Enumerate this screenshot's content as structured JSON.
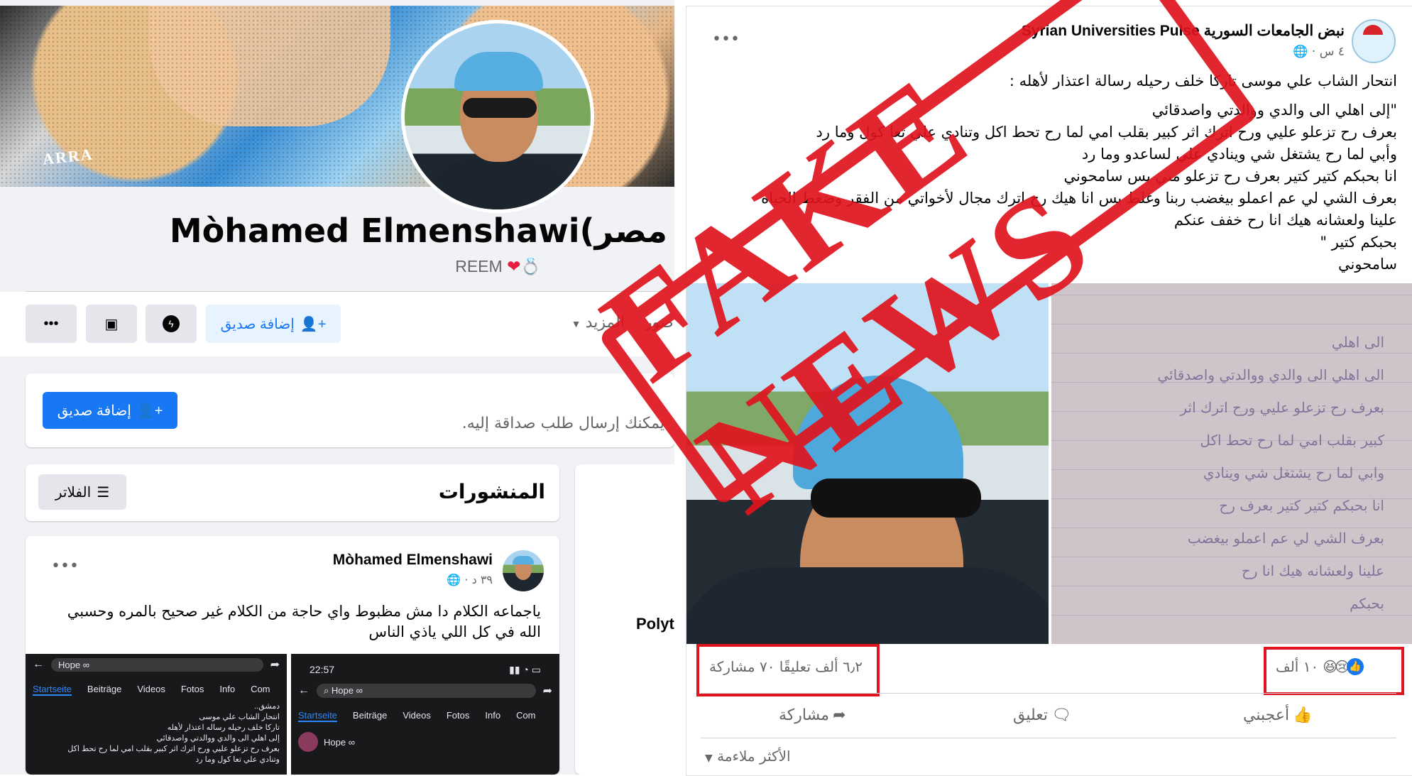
{
  "profile": {
    "name": "Mòhamed Elmenshawi(مصر",
    "subtitle": "REEM",
    "tabs": {
      "photos_partial": "صور",
      "more": "المزيد"
    },
    "buttons": {
      "add_friend": "إضافة صديق",
      "add_friend_2": "إضافة صديق",
      "filters": "الفلاتر"
    },
    "friend_request_note": "يمكنك إرسال طلب صداقة إليه.",
    "posts_heading": "المنشورات",
    "partial_sidebar_text": "Polyt",
    "post": {
      "author": "Mòhamed Elmenshawi",
      "time": "٣٩ د ·",
      "text": "ياجماعه  الكلام دا مش مظبوط واي حاجة من الكلام غير صحيح بالمره وحسبي الله في كل اللي ياذي الناس",
      "screenshot_left": {
        "search": "Hope ∞",
        "tabs": [
          "Startseite",
          "Beiträge",
          "Videos",
          "Fotos",
          "Info",
          "Com"
        ],
        "lines": [
          "دمشق..",
          "انتحار الشاب علي موسى",
          "تاركا خلف رحيله رساله اعتذار لأهله",
          "إلى اهلي الى والدي ووالدتي واصدقائي",
          "بعرف رح تزعلو عليي ورح اترك اثر كبير بقلب امي لما رح تحط اكل",
          "وتنادي علي تعا كول وما رد"
        ]
      },
      "screenshot_right": {
        "clock": "22:57",
        "search": "Hope ∞",
        "tabs": [
          "Startseite",
          "Beiträge",
          "Videos",
          "Fotos",
          "Info",
          "Com"
        ],
        "page_name": "Hope ∞"
      }
    }
  },
  "source_post": {
    "page_name": "Syrian Universities Pulse نبض الجامعات السورية",
    "time": "٤ س ·",
    "lines": [
      "انتحار الشاب علي موسى تاركا خلف رحيله رسالة اعتذار لأهله :",
      "\"إلى اهلي الى والدي ووالدتي واصدقائي",
      "بعرف رح تزعلو عليي ورح اترك اثر كبير بقلب امي لما رح تحط اكل وتنادي علي تعا كول وما رد",
      "وأبي لما رح يشتغل شي وينادي علي لساعدو وما رد",
      "انا بحبكم كتير كتير بعرف رح تزعلو مني بس سامحوني",
      "بعرف الشي لي عم اعملو بيغضب ربنا وغلط بس انا هيك رح اترك مجال لأخواتي من الفقر وضغط الحياه",
      "علينا ولعشانه هيك انا رح خفف عنكم",
      "بحبكم كتير \"",
      "سامحوني"
    ],
    "handwriting": [
      "الى اهلي",
      "الى اهلي الى والدي ووالدتي واصدقائي",
      "بعرف رح تزعلو عليي ورح اترك اثر",
      "كبير بقلب امي لما رح تحط اكل",
      "وابي لما رح يشتغل شي وينادي",
      "انا بحبكم كتير كتير بعرف رح",
      "بعرف الشي لي عم اعملو بيغضب",
      "علينا ولعشانه هيك انا رح",
      "بحبكم"
    ],
    "stamp": "FAKE NEWS",
    "reactions_count": "١٠ ألف",
    "comments_shares": "٦٫٢ ألف تعليقًا ٧٠ مشاركة",
    "actions": {
      "like": "أعجبني",
      "comment": "تعليق",
      "share": "مشاركة"
    },
    "sort_label": "الأكثر ملاءمة"
  },
  "colors": {
    "facebook_blue": "#1877f2",
    "stamp_red": "#e0141e"
  }
}
